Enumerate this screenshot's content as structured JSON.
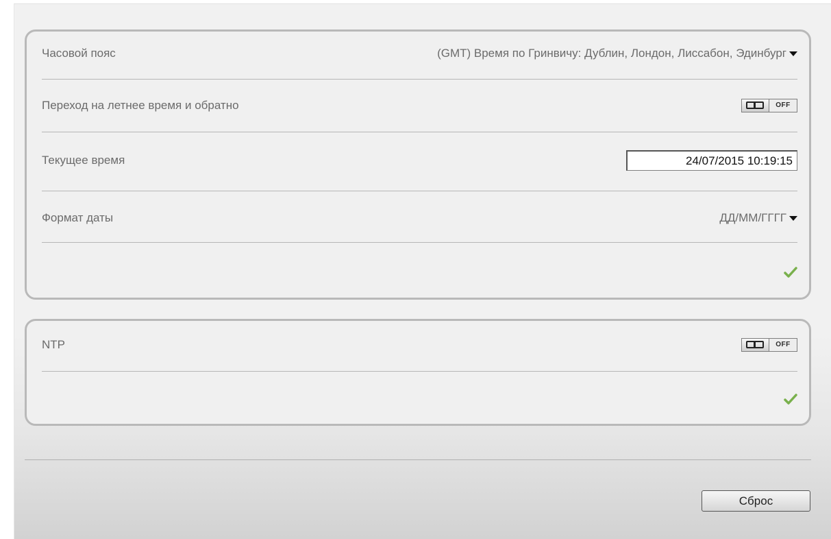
{
  "time_settings": {
    "timezone": {
      "label": "Часовой пояс",
      "value": "(GMT) Время по Гринвичу: Дублин, Лондон, Лиссабон, Эдинбург"
    },
    "dst": {
      "label": "Переход на летнее время и обратно",
      "state": "OFF"
    },
    "current_time": {
      "label": "Текущее время",
      "value": "24/07/2015 10:19:15"
    },
    "date_format": {
      "label": "Формат даты",
      "value": "ДД/ММ/ГГГГ"
    }
  },
  "ntp": {
    "label": "NTP",
    "state": "OFF"
  },
  "reset_label": "Сброс",
  "colors": {
    "checkmark": "#79b04c",
    "panel_border": "#b9b9b9",
    "label_text": "#6b6b6b"
  },
  "icons": {
    "apply": "checkmark-icon",
    "dropdown": "caret-down-icon",
    "toggle": "toggle-switch-icon"
  }
}
